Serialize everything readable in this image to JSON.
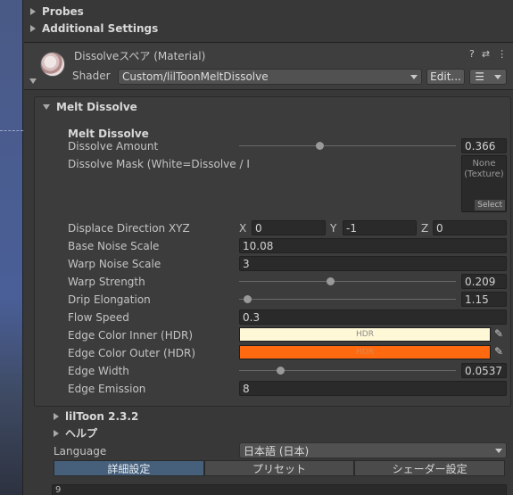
{
  "folds": {
    "probes": "Probes",
    "additional_settings": "Additional Settings"
  },
  "header": {
    "material_title": "Dissolveスペア (Material)",
    "shader_label": "Shader",
    "shader_value": "Custom/lilToonMeltDissolve",
    "edit_button": "Edit...",
    "help_icon": "?",
    "settings_icon": "⇄",
    "menu_icon": "⋮",
    "list_icon": "☰"
  },
  "section": {
    "title": "Melt Dissolve",
    "subtitle": "Melt Dissolve",
    "dissolve_amount": {
      "label": "Dissolve Amount",
      "value": "0.366",
      "fraction": 0.366
    },
    "dissolve_mask": {
      "label": "Dissolve Mask (White=Dissolve / I",
      "tex_line1": "None",
      "tex_line2": "(Texture)",
      "select": "Select"
    },
    "displace": {
      "label": "Displace Direction XYZ",
      "x_label": "X",
      "x": "0",
      "y_label": "Y",
      "y": "-1",
      "z_label": "Z",
      "z": "0"
    },
    "base_noise": {
      "label": "Base Noise Scale",
      "value": "10.08"
    },
    "warp_noise": {
      "label": "Warp Noise Scale",
      "value": "3"
    },
    "warp_strength": {
      "label": "Warp Strength",
      "value": "0.209",
      "fraction": 0.418
    },
    "drip": {
      "label": "Drip Elongation",
      "value": "1.15",
      "fraction": 0.02
    },
    "flow_speed": {
      "label": "Flow Speed",
      "value": "0.3"
    },
    "edge_inner": {
      "label": "Edge Color Inner (HDR)",
      "hdr": "HDR",
      "color": "#fff8d6"
    },
    "edge_outer": {
      "label": "Edge Color Outer (HDR)",
      "hdr": "HDR",
      "color": "#ff6a10"
    },
    "edge_width": {
      "label": "Edge Width",
      "value": "0.0537",
      "fraction": 0.18
    },
    "edge_emission": {
      "label": "Edge Emission",
      "value": "8"
    }
  },
  "lower": {
    "liltoon": "lilToon 2.3.2",
    "help": "ヘルプ",
    "language_label": "Language",
    "language_value": "日本語 (日本)",
    "tabs": [
      "詳細設定",
      "プリセット",
      "シェーダー設定"
    ],
    "bottom_value": "9"
  }
}
